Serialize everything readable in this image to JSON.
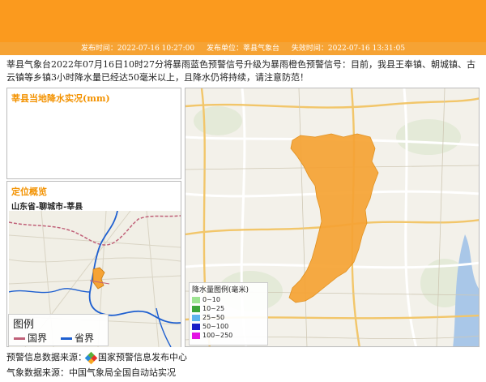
{
  "meta": {
    "publish_time": "发布时间：2022-07-16 10:27:00",
    "publisher": "发布单位：莘县气象台",
    "expire_time": "失效时间：2022-07-16 13:31:05"
  },
  "alert_text": "莘县气象台2022年07月16日10时27分将暴雨蓝色预警信号升级为暴雨橙色预警信号：目前，我县王奉镇、朝城镇、古云镇等乡镇3小时降水量已经达50毫米以上，且降水仍将持续，请注意防范！",
  "rain_panel": {
    "title": "莘县当地降水实况(mm)"
  },
  "location_panel": {
    "title": "定位概览",
    "path": "山东省-聊城市-莘县",
    "legend": {
      "title": "图例",
      "items": [
        "国界",
        "省界"
      ]
    },
    "colors": {
      "country_border": "#c06078",
      "province_border": "#1e5fd0",
      "region": "#f6a334"
    }
  },
  "rain_legend": {
    "title": "降水量图例(毫米)",
    "items": [
      {
        "label": "0~10",
        "color": "#9ee493"
      },
      {
        "label": "10~25",
        "color": "#3ca63a"
      },
      {
        "label": "25~50",
        "color": "#5db4ee"
      },
      {
        "label": "50~100",
        "color": "#1a20c8"
      },
      {
        "label": "100~250",
        "color": "#e414e4"
      }
    ]
  },
  "sources": {
    "warning": "预警信息数据来源：",
    "warning_org": "国家预警信息发布中心",
    "weather": "气象数据来源：中国气象局全国自动站实况"
  },
  "theme": {
    "header": "#fb9a1e",
    "accent": "#f39200",
    "county_fill": "#f6a334"
  }
}
